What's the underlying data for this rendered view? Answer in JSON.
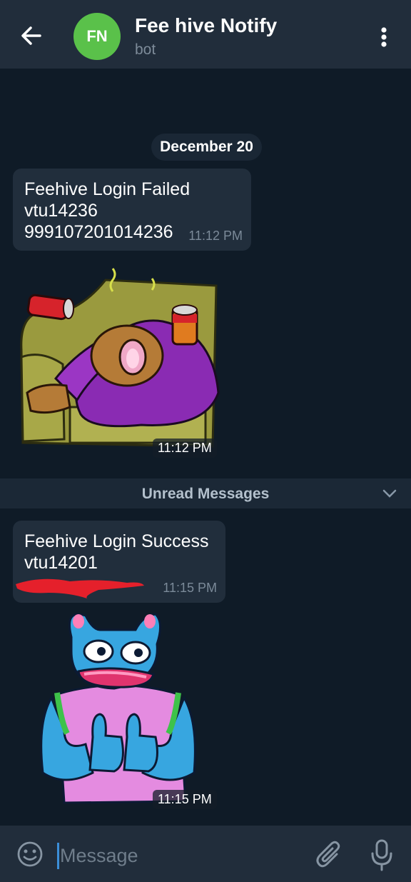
{
  "header": {
    "avatar_initials": "FN",
    "avatar_color": "#5ac14a",
    "title": "Fee hive Notify",
    "subtitle": "bot"
  },
  "chat": {
    "date_chip": "December 20",
    "messages": [
      {
        "lines": [
          "Feehive Login Failed",
          "vtu14236",
          "999107201014236"
        ],
        "time": "11:12 PM"
      },
      {
        "sticker": "sloth-on-couch",
        "time": "11:12 PM"
      },
      {
        "lines": [
          "Feehive Login Success",
          "vtu14201"
        ],
        "redacted_line": true,
        "time": "11:15 PM"
      },
      {
        "sticker": "frog-thumbs-up",
        "time": "11:15 PM"
      }
    ],
    "unread_label": "Unread Messages"
  },
  "input": {
    "placeholder": "Message"
  },
  "icons": {
    "back": "arrow-left-icon",
    "menu": "more-vertical-icon",
    "emoji": "smiley-icon",
    "attach": "paperclip-icon",
    "mic": "microphone-icon",
    "unread_toggle": "chevron-down-icon"
  },
  "colors": {
    "header_bg": "#212d3b",
    "chat_bg": "#0f1b27",
    "bubble_bg": "#212e3c",
    "accent": "#3b8ed8",
    "redaction": "#e5202b"
  }
}
